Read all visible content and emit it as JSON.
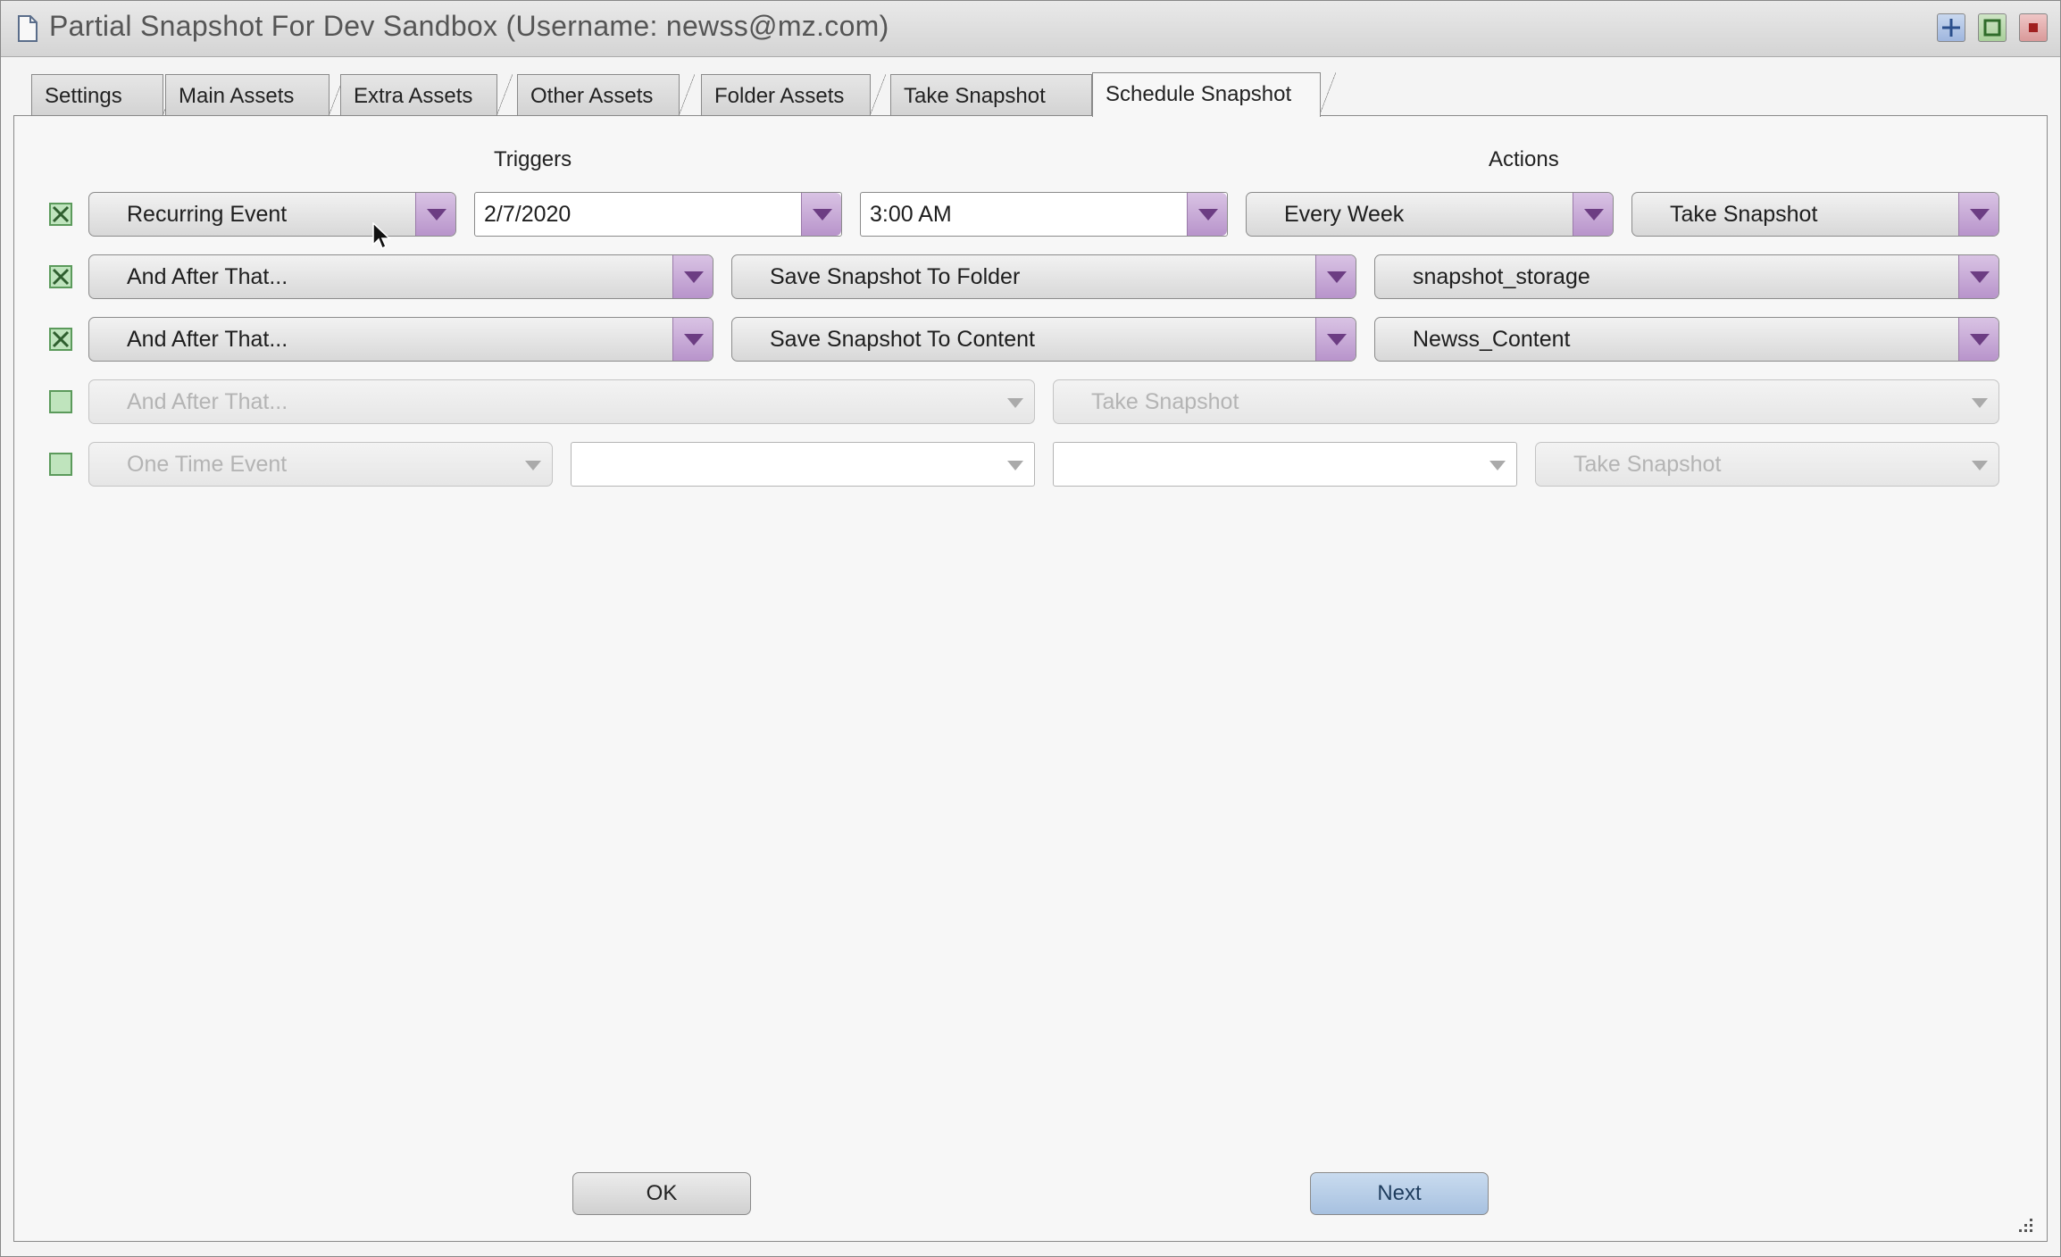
{
  "window": {
    "title": "Partial Snapshot For Dev Sandbox (Username: newss@mz.com)"
  },
  "tabs": [
    {
      "label": "Settings"
    },
    {
      "label": "Main Assets"
    },
    {
      "label": "Extra Assets"
    },
    {
      "label": "Other Assets"
    },
    {
      "label": "Folder Assets"
    },
    {
      "label": "Take Snapshot"
    },
    {
      "label": "Schedule Snapshot",
      "active": true
    }
  ],
  "headers": {
    "triggers": "Triggers",
    "actions": "Actions"
  },
  "rows": [
    {
      "checked": true,
      "trigger": "Recurring Event",
      "date": "2/7/2020",
      "time": "3:00 AM",
      "frequency": "Every Week",
      "action": "Take Snapshot"
    },
    {
      "checked": true,
      "trigger": "And After That...",
      "action": "Save Snapshot To Folder",
      "target": "snapshot_storage"
    },
    {
      "checked": true,
      "trigger": "And After That...",
      "action": "Save Snapshot To Content",
      "target": "Newss_Content"
    },
    {
      "checked": false,
      "trigger": "And After That...",
      "action": "Take Snapshot"
    },
    {
      "checked": false,
      "trigger": "One Time Event",
      "date": "",
      "time": "",
      "action": "Take Snapshot"
    }
  ],
  "buttons": {
    "ok": "OK",
    "next": "Next"
  },
  "colors": {
    "dropdown_arrow": "#b894cb",
    "checkbox": "#bfe4bd",
    "next_button": "#a7c1e0"
  }
}
